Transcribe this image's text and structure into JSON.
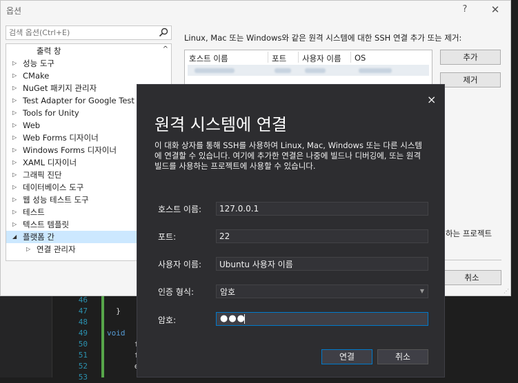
{
  "options": {
    "title": "옵션",
    "help": "?",
    "close": "✕",
    "search_placeholder": "검색 옵션(Ctrl+E)",
    "tree": [
      {
        "label": "출력 창",
        "arrow": ""
      },
      {
        "label": "성능 도구",
        "arrow": "▷"
      },
      {
        "label": "CMake",
        "arrow": "▷"
      },
      {
        "label": "NuGet 패키지 관리자",
        "arrow": "▷"
      },
      {
        "label": "Test Adapter for Google Test",
        "arrow": "▷"
      },
      {
        "label": "Tools for Unity",
        "arrow": "▷"
      },
      {
        "label": "Web",
        "arrow": "▷"
      },
      {
        "label": "Web Forms 디자이너",
        "arrow": "▷"
      },
      {
        "label": "Windows Forms 디자이너",
        "arrow": "▷"
      },
      {
        "label": "XAML 디자이너",
        "arrow": "▷"
      },
      {
        "label": "그래픽 진단",
        "arrow": "▷"
      },
      {
        "label": "데이터베이스 도구",
        "arrow": "▷"
      },
      {
        "label": "웹 성능 테스트 도구",
        "arrow": "▷"
      },
      {
        "label": "테스트",
        "arrow": "▷"
      },
      {
        "label": "텍스트 템플릿",
        "arrow": "▷"
      },
      {
        "label": "플랫폼 간",
        "arrow": "◢"
      },
      {
        "label": "연결 관리자",
        "arrow": "▷"
      }
    ],
    "description": "Linux, Mac 또는 Windows와 같은 원격 시스템에 대한 SSH 연결 추가 또는 제거:",
    "table_headers": [
      "호스트 이름",
      "포트",
      "사용자 이름",
      "OS"
    ],
    "add_label": "추가",
    "remove_label": "제거",
    "partial_text": "하는 프로젝트",
    "cancel_label": "취소"
  },
  "connect": {
    "close": "×",
    "title": "원격 시스템에 연결",
    "description": "이 대화 상자를 통해 SSH를 사용하여 Linux, Mac, Windows 또는 다른 시스템에 연결할 수 있습니다. 여기에 추가한 연결은 나중에 빌드나 디버깅에, 또는 원격 빌드를 사용하는 프로젝트에 사용할 수 있습니다.",
    "host_label": "호스트 이름:",
    "host_value": "127.0.0.1",
    "port_label": "포트:",
    "port_value": "22",
    "user_label": "사용자 이름:",
    "user_value": "Ubuntu 사용자 이름",
    "auth_label": "인증 형식:",
    "auth_value": "암호",
    "password_label": "암호:",
    "password_value": "●●●",
    "connect_label": "연결",
    "cancel_label": "취소"
  },
  "editor": {
    "lines": [
      {
        "n": "46",
        "code": "    "
      },
      {
        "n": "47",
        "code": "  }"
      },
      {
        "n": "48",
        "code": ""
      },
      {
        "n": "49",
        "code": "void"
      },
      {
        "n": "50",
        "code": "      f"
      },
      {
        "n": "51",
        "code": "      f"
      },
      {
        "n": "52",
        "code": "      e"
      },
      {
        "n": "53",
        "code": ""
      }
    ]
  }
}
